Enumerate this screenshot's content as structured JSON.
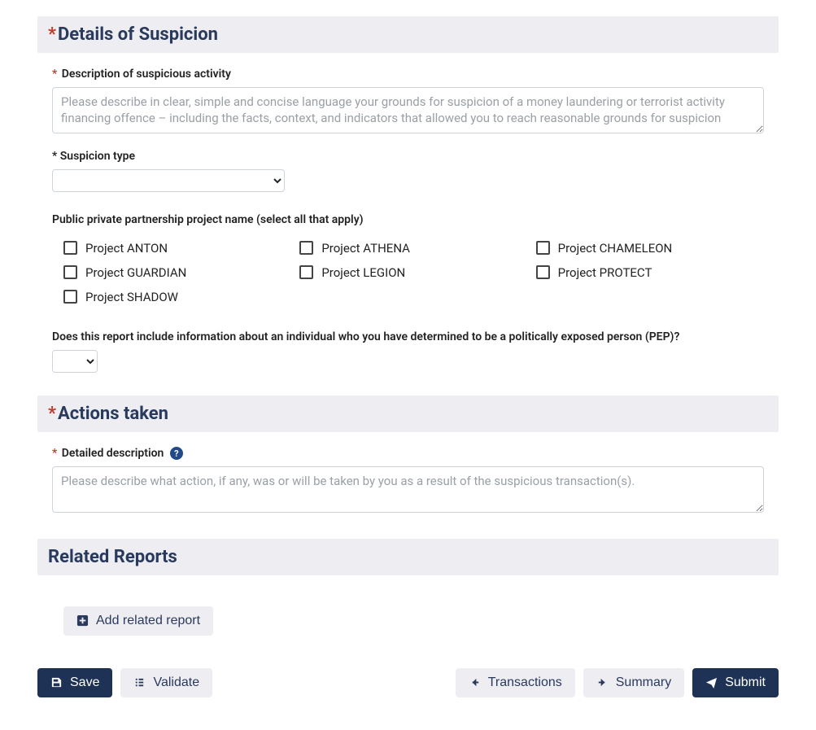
{
  "details": {
    "heading": "Details of Suspicion",
    "description_label": "Description of suspicious activity",
    "description_placeholder": "Please describe in clear, simple and concise language your grounds for suspicion of a money laundering or terrorist activity financing offence – including the facts, context, and indicators that allowed you to reach reasonable grounds for suspicion",
    "suspicion_type_label": "Suspicion type",
    "ppp_label": "Public private partnership project name (select all that apply)",
    "projects": [
      "Project ANTON",
      "Project ATHENA",
      "Project CHAMELEON",
      "Project GUARDIAN",
      "Project LEGION",
      "Project PROTECT",
      "Project SHADOW"
    ],
    "pep_label": "Does this report include information about an individual who you have determined to be a politically exposed person (PEP)?"
  },
  "actions": {
    "heading": "Actions taken",
    "detailed_label": "Detailed description",
    "detailed_placeholder": "Please describe what action, if any, was or will be taken by you as a result of the suspicious transaction(s)."
  },
  "related": {
    "heading": "Related Reports",
    "add_button": "Add related report"
  },
  "footer": {
    "save": "Save",
    "validate": "Validate",
    "transactions": "Transactions",
    "summary": "Summary",
    "submit": "Submit"
  }
}
